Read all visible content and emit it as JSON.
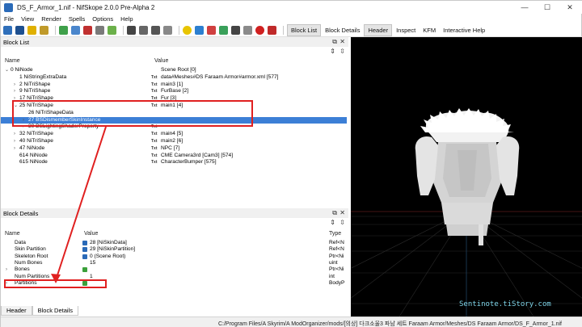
{
  "window": {
    "title": "DS_F_Armor_1.nif - NifSkope 2.0.0 Pre-Alpha 2",
    "minimize": "—",
    "maximize": "☐",
    "close": "✕"
  },
  "menu": [
    "File",
    "View",
    "Render",
    "Spells",
    "Options",
    "Help"
  ],
  "toolbar_tabs": [
    "Block List",
    "Block Details",
    "Header",
    "Inspect",
    "KFM",
    "Interactive Help"
  ],
  "block_list": {
    "title": "Block List",
    "columns": {
      "name": "Name",
      "value": "Value"
    },
    "rows": [
      {
        "caret": "⌄",
        "name": "0 NiNode",
        "txt": "",
        "value": "Scene Root [0]"
      },
      {
        "caret": "",
        "name": "1 NiStringExtraData",
        "txt": "Txt",
        "value": "data#Meshes#DS Faraam Armor#armor.xml [577]"
      },
      {
        "caret": "›",
        "name": "2 NiTriShape",
        "txt": "Txt",
        "value": "main3 [1]"
      },
      {
        "caret": "›",
        "name": "9 NiTriShape",
        "txt": "Txt",
        "value": "FurBase [2]"
      },
      {
        "caret": "›",
        "name": "17 NiTriShape",
        "txt": "Txt",
        "value": "Fur [3]"
      },
      {
        "caret": "⌄",
        "name": "25 NiTriShape",
        "txt": "Txt",
        "value": "main1 [4]"
      },
      {
        "caret": "",
        "name": "26 NiTriShapeData",
        "txt": "",
        "value": ""
      },
      {
        "caret": "›",
        "name": "27 BSDismemberSkinInstance",
        "txt": "",
        "value": ""
      },
      {
        "caret": "›",
        "name": "30 BSLightingShaderProperty",
        "txt": "Txt",
        "value": ""
      },
      {
        "caret": "›",
        "name": "32 NiTriShape",
        "txt": "Txt",
        "value": "main4 [5]"
      },
      {
        "caret": "›",
        "name": "40 NiTriShape",
        "txt": "Txt",
        "value": "main2 [6]"
      },
      {
        "caret": "›",
        "name": "47 NiNode",
        "txt": "Txt",
        "value": "NPC [7]"
      },
      {
        "caret": "",
        "name": "614 NiNode",
        "txt": "Txt",
        "value": "CME Camera3rd [Cam3] [574]"
      },
      {
        "caret": "",
        "name": "615 NiNode",
        "txt": "Txt",
        "value": "CharacterBumper [575]"
      }
    ]
  },
  "block_details": {
    "title": "Block Details",
    "columns": {
      "name": "Name",
      "value": "Value",
      "type": "Type"
    },
    "rows": [
      {
        "caret": "",
        "name": "Data",
        "value": "28 [NiSkinData]",
        "type": "Ref<N",
        "icon_color": "#2a6ab8"
      },
      {
        "caret": "",
        "name": "Skin Partition",
        "value": "29 [NiSkinPartition]",
        "type": "Ref<N",
        "icon_color": "#2a6ab8"
      },
      {
        "caret": "",
        "name": "Skeleton Root",
        "value": "0 (Scene Root)",
        "type": "Ptr<Ni",
        "icon_color": "#2a6ab8"
      },
      {
        "caret": "",
        "name": "Num Bones",
        "value": "15",
        "type": "uint",
        "icon_color": ""
      },
      {
        "caret": "›",
        "name": "Bones",
        "value": "",
        "type": "Ptr<Ni",
        "icon_color": "#3aa03a"
      },
      {
        "caret": "",
        "name": "Num Partitions",
        "value": "1",
        "type": "int",
        "icon_color": ""
      },
      {
        "caret": "›",
        "name": "Partitions",
        "value": "",
        "type": "BodyP",
        "icon_color": "#3aa03a"
      }
    ]
  },
  "bottom_tabs": [
    "Header",
    "Block Details"
  ],
  "watermark": "Sentinote.tiStory.com",
  "status_path": "C:/Program Files/A Skyrim/A ModOrganizer/mods/[의상] 다크소울3 파남 세트 Faraam Armor/Meshes/DS Faraam Armor/DS_F_Armor_1.nif"
}
